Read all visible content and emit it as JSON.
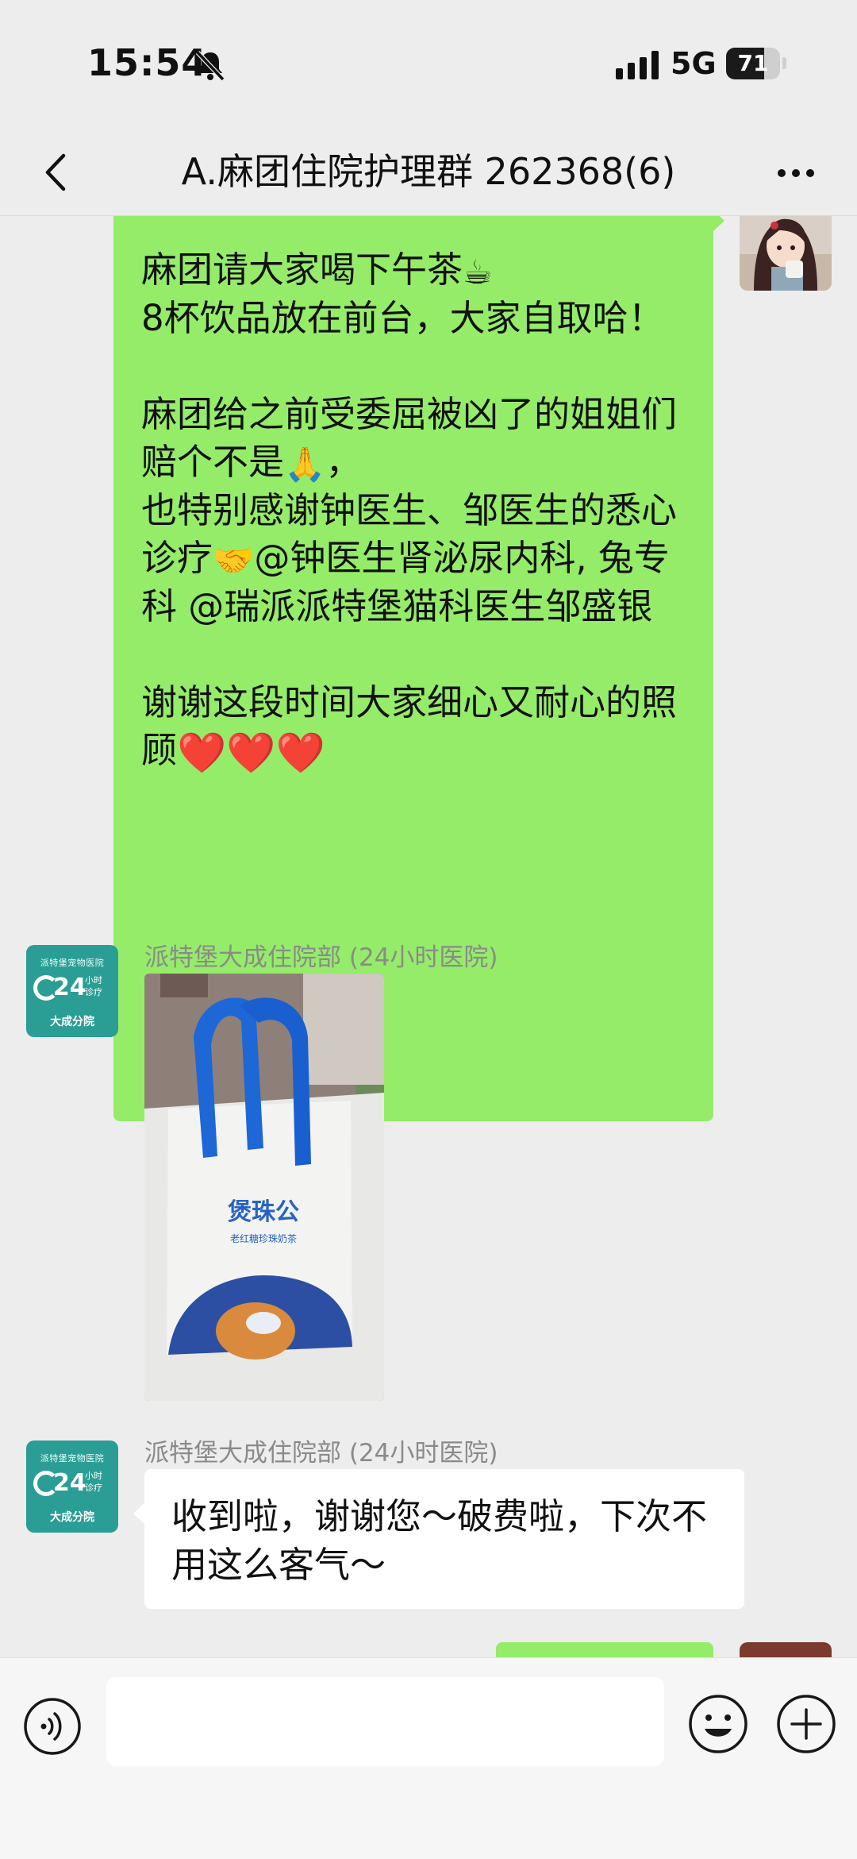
{
  "status_bar": {
    "time": "15:54",
    "network": "5G",
    "battery_level": "71",
    "battery_fraction": 0.71
  },
  "nav": {
    "title": "A.麻团住院护理群 262368(6)"
  },
  "messages": [
    {
      "sender": "me",
      "type": "text",
      "segments": [
        {
          "type": "text",
          "value": "麻团请大家喝下午茶"
        },
        {
          "type": "emoji",
          "value": "☕"
        },
        {
          "type": "text",
          "value": "\n8杯饮品放在前台，大家自取哈！\n\n麻团给之前受委屈被凶了的姐姐们赔个不是"
        },
        {
          "type": "emoji",
          "value": "🙏"
        },
        {
          "type": "text",
          "value": "，\n也特别感谢钟医生、邹医生的悉心诊疗"
        },
        {
          "type": "emoji",
          "value": "🤝"
        },
        {
          "type": "text",
          "value": "@钟医生肾泌尿内科, 兔专科 @瑞派派特堡猫科医生邹盛银\n\n谢谢这段时间大家细心又耐心的照顾"
        },
        {
          "type": "emoji",
          "value": "❤️❤️❤️"
        }
      ]
    },
    {
      "sender": "派特堡大成住院部 (24小时医院)",
      "type": "image",
      "image_text": {
        "brand": "煲珠公",
        "subtitle": "老红糖珍珠奶茶"
      }
    },
    {
      "sender": "派特堡大成住院部 (24小时医院)",
      "type": "text",
      "text": "收到啦，谢谢您～破费啦，下次不用这么客气～"
    }
  ],
  "hospital_avatar": {
    "top_text": "派特堡宠物医院",
    "big_number": "24",
    "small_text_1": "小时",
    "small_text_2": "诊疗",
    "bottom_text": "大成分院"
  },
  "input": {
    "value": "",
    "placeholder": ""
  },
  "colors": {
    "background": "#ededed",
    "my_bubble": "#95ec69",
    "their_bubble": "#ffffff",
    "hospital_brand": "#2a9e94"
  },
  "icons": {
    "back": "chevron-left-icon",
    "more": "more-dots-icon",
    "mute": "bell-slash-icon",
    "voice": "voice-icon",
    "emoji": "emoji-icon",
    "plus": "plus-icon"
  }
}
